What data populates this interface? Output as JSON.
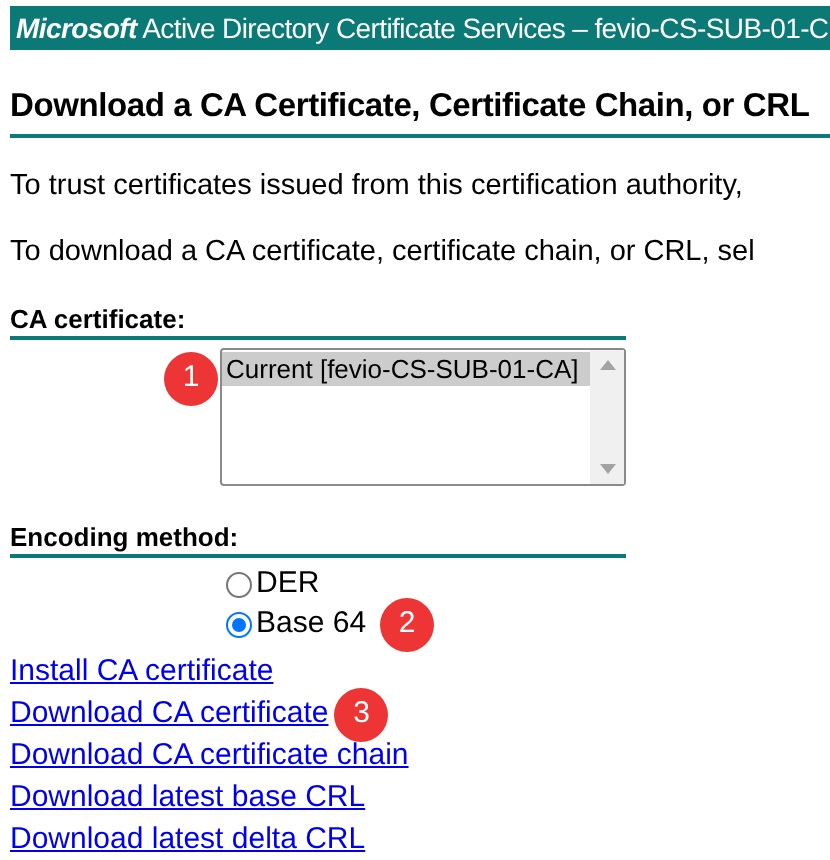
{
  "header": {
    "brand": "Microsoft",
    "title": "Active Directory Certificate Services  –  fevio-CS-SUB-01-C"
  },
  "heading": "Download a CA Certificate, Certificate Chain, or CRL",
  "paragraphs": [
    "To trust certificates issued from this certification authority,",
    "To download a CA certificate, certificate chain, or CRL, sel"
  ],
  "ca_certificate": {
    "label": "CA certificate:",
    "options": [
      {
        "text": "Current [fevio-CS-SUB-01-CA]",
        "selected": true
      }
    ],
    "badge": "1"
  },
  "encoding": {
    "label": "Encoding method:",
    "options": [
      {
        "text": "DER",
        "selected": false
      },
      {
        "text": "Base 64",
        "selected": true,
        "badge": "2"
      }
    ]
  },
  "links": [
    {
      "text": "Install CA certificate"
    },
    {
      "text": "Download CA certificate",
      "badge": "3"
    },
    {
      "text": "Download CA certificate chain"
    },
    {
      "text": "Download latest base CRL"
    },
    {
      "text": "Download latest delta CRL"
    }
  ]
}
